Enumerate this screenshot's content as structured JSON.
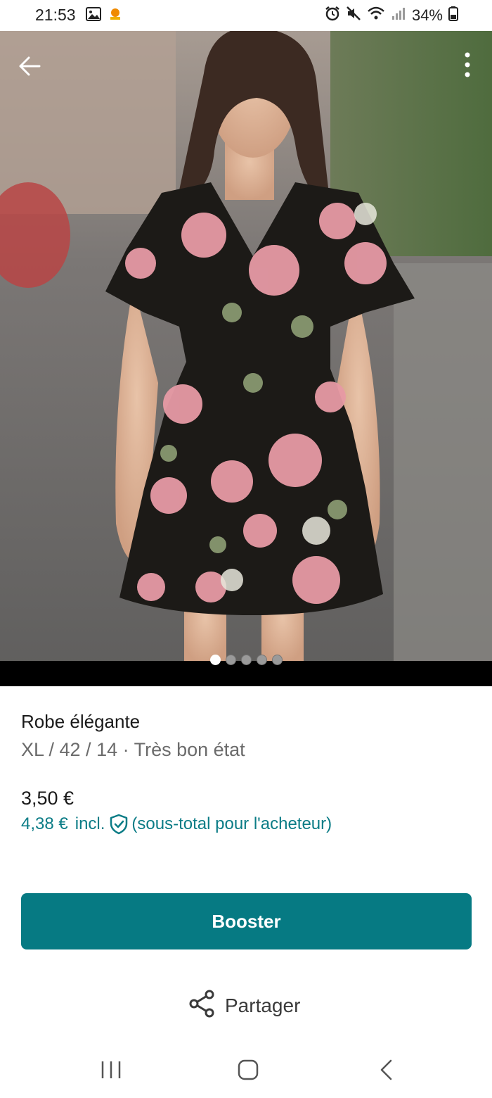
{
  "status_bar": {
    "time": "21:53",
    "battery": "34%",
    "icons": [
      "gallery-icon",
      "app-notification-icon",
      "alarm-icon",
      "mute-icon",
      "wifi-icon",
      "signal-icon",
      "battery-icon"
    ]
  },
  "hero": {
    "description_icons": [
      "back-arrow-icon",
      "more-vertical-icon"
    ],
    "carousel": {
      "count": 5,
      "active_index": 0
    }
  },
  "item": {
    "title": "Robe élégante",
    "meta": "XL / 42 / 14 · Très bon état",
    "price": "3,50 €",
    "buyer_price": "4,38 €",
    "buyer_incl": "incl.",
    "buyer_note": "(sous-total pour l'acheteur)"
  },
  "actions": {
    "booster_label": "Booster",
    "share_label": "Partager"
  },
  "colors": {
    "accent": "#067a83",
    "accent_text": "#0b7c86"
  }
}
